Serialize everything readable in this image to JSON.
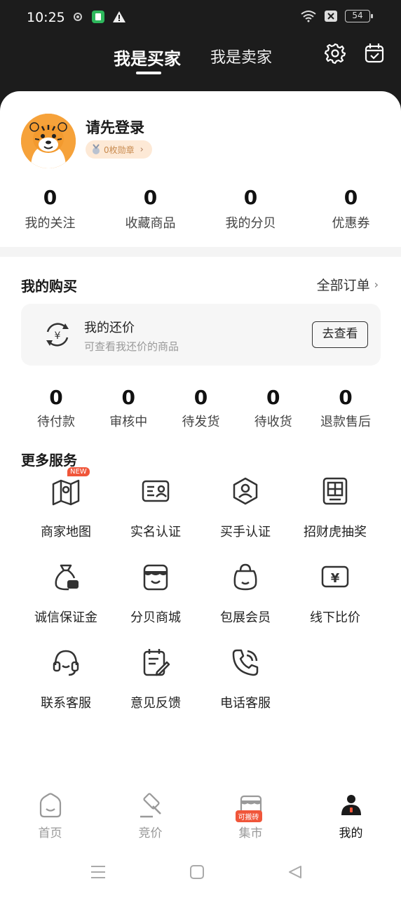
{
  "status_bar": {
    "time": "10:25",
    "battery": "54"
  },
  "header": {
    "tabs": [
      {
        "label": "我是买家",
        "active": true
      },
      {
        "label": "我是卖家",
        "active": false
      }
    ]
  },
  "profile": {
    "login_prompt": "请先登录",
    "badge_text": "0枚勋章"
  },
  "account_stats": [
    {
      "value": "0",
      "label": "我的关注"
    },
    {
      "value": "0",
      "label": "收藏商品"
    },
    {
      "value": "0",
      "label": "我的分贝"
    },
    {
      "value": "0",
      "label": "优惠券"
    }
  ],
  "purchases": {
    "title": "我的购买",
    "all_orders": "全部订单",
    "bargain": {
      "title": "我的还价",
      "subtitle": "可查看我还价的商品",
      "button": "去查看"
    },
    "order_stats": [
      {
        "value": "0",
        "label": "待付款"
      },
      {
        "value": "0",
        "label": "审核中"
      },
      {
        "value": "0",
        "label": "待发货"
      },
      {
        "value": "0",
        "label": "待收货"
      },
      {
        "value": "0",
        "label": "退款售后"
      }
    ]
  },
  "services": {
    "title": "更多服务",
    "new_tag": "NEW",
    "items": [
      {
        "label": "商家地图",
        "icon": "map-icon"
      },
      {
        "label": "实名认证",
        "icon": "id-card-icon"
      },
      {
        "label": "买手认证",
        "icon": "buyer-badge-icon"
      },
      {
        "label": "招财虎抽奖",
        "icon": "lottery-icon"
      },
      {
        "label": "诚信保证金",
        "icon": "deposit-bag-icon"
      },
      {
        "label": "分贝商城",
        "icon": "store-icon"
      },
      {
        "label": "包展会员",
        "icon": "bag-icon"
      },
      {
        "label": "线下比价",
        "icon": "yen-card-icon"
      },
      {
        "label": "联系客服",
        "icon": "headset-icon"
      },
      {
        "label": "意见反馈",
        "icon": "feedback-icon"
      },
      {
        "label": "电话客服",
        "icon": "phone-icon"
      }
    ]
  },
  "bottom_nav": {
    "items": [
      {
        "label": "首页",
        "icon": "home-icon"
      },
      {
        "label": "竞价",
        "icon": "auction-hammer-icon"
      },
      {
        "label": "集市",
        "icon": "market-icon"
      },
      {
        "label": "我的",
        "icon": "profile-icon",
        "active": true
      }
    ],
    "market_tag": "可搬砖"
  },
  "colors": {
    "accent": "#f0563a",
    "header_bg": "#1c1c1c",
    "avatar_bg": "#f6a23a"
  }
}
